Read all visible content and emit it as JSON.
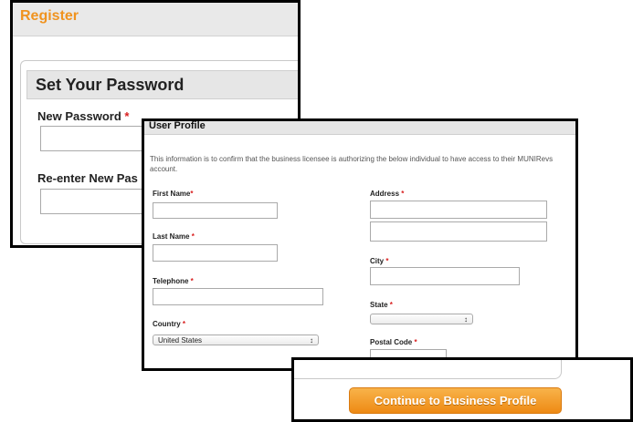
{
  "register": {
    "title": "Register",
    "section_title": "Set Your Password",
    "new_password_label": "New Password",
    "reenter_label": "Re-enter New Pas",
    "required_mark": "*"
  },
  "profile": {
    "title": "User Profile",
    "info": "This information is to confirm that the business licensee is authorizing the below individual to have access to their MUNIRevs account.",
    "first_name_label": "First Name",
    "last_name_label": "Last Name",
    "telephone_label": "Telephone",
    "country_label": "Country",
    "country_value": "United States",
    "address_label": "Address",
    "city_label": "City",
    "state_label": "State",
    "state_value": "",
    "postal_code_label": "Postal Code",
    "required_mark": "*"
  },
  "actions": {
    "continue_label": "Continue to Business Profile"
  },
  "colors": {
    "accent_orange": "#f0931f",
    "required_red": "#d81e1e"
  }
}
